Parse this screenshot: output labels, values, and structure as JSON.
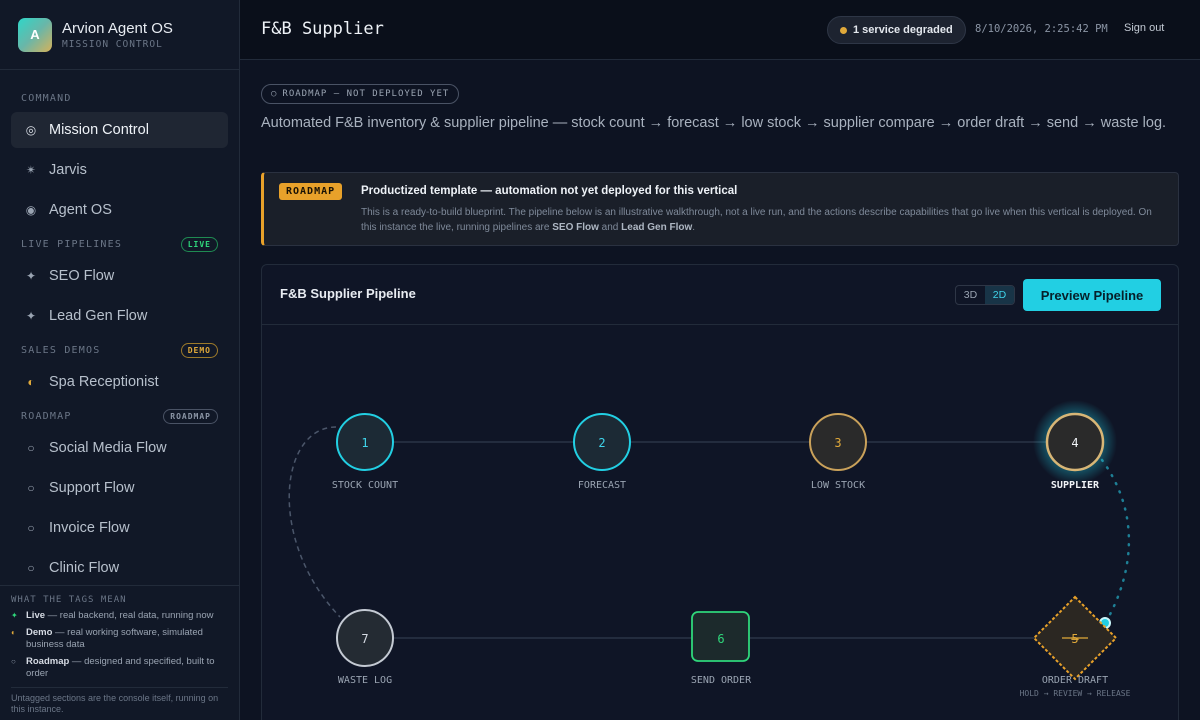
{
  "brand": {
    "logo_letter": "A",
    "name": "Arvion Agent OS",
    "subtitle": "MISSION CONTROL"
  },
  "sidebar": {
    "command_label": "COMMAND",
    "command_items": [
      {
        "icon": "target-icon",
        "glyph": "◎",
        "label": "Mission Control"
      },
      {
        "icon": "spark-icon",
        "glyph": "✴",
        "label": "Jarvis"
      },
      {
        "icon": "radio-icon",
        "glyph": "◉",
        "label": "Agent OS"
      }
    ],
    "live_label": "LIVE PIPELINES",
    "live_tag": "LIVE",
    "live_items": [
      {
        "icon": "sparkle-icon",
        "glyph": "✦",
        "label": "SEO Flow"
      },
      {
        "icon": "sparkle-icon",
        "glyph": "✦",
        "label": "Lead Gen Flow"
      }
    ],
    "demo_label": "SALES DEMOS",
    "demo_tag": "DEMO",
    "demo_items": [
      {
        "icon": "half-circle-icon",
        "glyph": "◐",
        "label": "Spa Receptionist"
      }
    ],
    "roadmap_label": "ROADMAP",
    "roadmap_tag": "ROADMAP",
    "roadmap_items": [
      {
        "icon": "circle-icon",
        "glyph": "○",
        "label": "Social Media Flow"
      },
      {
        "icon": "circle-icon",
        "glyph": "○",
        "label": "Support Flow"
      },
      {
        "icon": "circle-icon",
        "glyph": "○",
        "label": "Invoice Flow"
      },
      {
        "icon": "circle-icon",
        "glyph": "○",
        "label": "Clinic Flow"
      }
    ]
  },
  "legend": {
    "title": "WHAT THE TAGS MEAN",
    "live_term": "Live",
    "live_desc": " — real backend, real data, running now",
    "demo_term": "Demo",
    "demo_desc": " — real working software, simulated business data",
    "roadmap_term": "Roadmap",
    "roadmap_desc": " — designed and specified, built to order",
    "footer": "Untagged sections are the console itself, running on this instance."
  },
  "header": {
    "title": "F&B Supplier",
    "status": "1 service degraded",
    "timestamp": "8/10/2026, 2:25:42 PM",
    "signout": "Sign out"
  },
  "main": {
    "chip": "ROADMAP — NOT DEPLOYED YET",
    "description": "Automated F&B inventory & supplier pipeline — stock count → forecast → low stock → supplier compare → order draft → send → waste log.",
    "banner": {
      "tag": "ROADMAP",
      "title": "Productized template — automation not yet deployed for this vertical",
      "body_start": "This is a ready-to-build blueprint. The pipeline below is an illustrative walkthrough, not a live run, and the actions describe capabilities that go live when this vertical is deployed. On this instance the live, running pipelines are ",
      "body_link1": "SEO Flow",
      "body_mid": " and ",
      "body_link2": "Lead Gen Flow",
      "body_end": "."
    },
    "panel": {
      "title": "F&B Supplier Pipeline",
      "view_3d": "3D",
      "view_2d": "2D",
      "preview_button": "Preview Pipeline"
    },
    "pipeline": {
      "nodes": [
        {
          "number": "1",
          "label": "STOCK COUNT",
          "state": "done"
        },
        {
          "number": "2",
          "label": "FORECAST",
          "state": "done"
        },
        {
          "number": "3",
          "label": "LOW STOCK",
          "state": "warning"
        },
        {
          "number": "4",
          "label": "SUPPLIER",
          "state": "active"
        },
        {
          "number": "5",
          "label": "ORDER DRAFT",
          "state": "gate",
          "sublabel": "HOLD → REVIEW → RELEASE"
        },
        {
          "number": "6",
          "label": "SEND ORDER",
          "state": "send"
        },
        {
          "number": "7",
          "label": "WASTE LOG",
          "state": "idle"
        }
      ]
    }
  },
  "colors": {
    "accent": "#22cfe3",
    "warning": "#e8a12a",
    "live": "#2fd67b",
    "background": "#0d1322"
  }
}
